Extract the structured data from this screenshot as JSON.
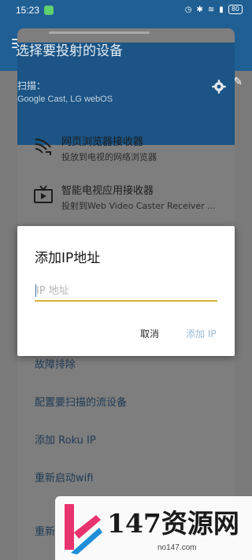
{
  "status_bar": {
    "time": "15:23",
    "battery": "80"
  },
  "sheet": {
    "title": "选择要投射的设备",
    "scan_label": "扫描：",
    "scan_value": "Google Cast, LG webOS"
  },
  "receivers": [
    {
      "title": "网页浏览器接收器",
      "subtitle": "投放到电视的网络浏览器",
      "icon": "web-wave-icon"
    },
    {
      "title": "智能电视应用接收器",
      "subtitle": "投射到Web Video Caster Receiver ...",
      "icon": "tv-icon"
    }
  ],
  "menu": {
    "items": [
      "故障排除",
      "配置要扫描的流设备",
      "添加 Roku IP",
      "重新启动wifi"
    ],
    "last_item": "重新"
  },
  "dialog": {
    "title": "添加IP地址",
    "input_placeholder": "IP 地址",
    "input_value": "",
    "cancel_label": "取消",
    "add_label": "添加 IP"
  },
  "watermark": {
    "text": "147资源网",
    "url": "no147.com"
  },
  "colors": {
    "primary": "#1f5f93",
    "accent_underline": "#d4b236",
    "disabled_button": "#9bbbd6"
  }
}
